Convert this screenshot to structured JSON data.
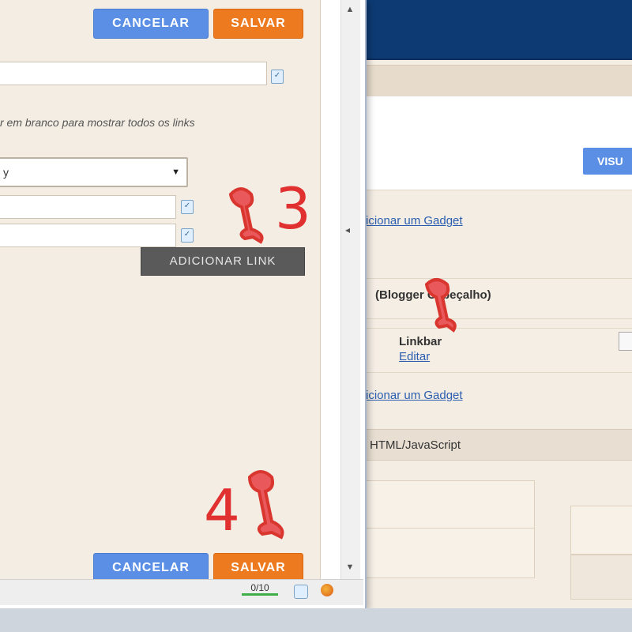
{
  "background_page": {
    "visualizar_label": "VISU",
    "add_gadget_link_1": "icionar um Gadget",
    "header_row_label": "(Blogger Cabeçalho)",
    "linkbar_title": "Linkbar",
    "linkbar_edit_link": "Editar",
    "add_gadget_link_2": "icionar um Gadget",
    "html_bar_label": "HTML/JavaScript"
  },
  "dialog": {
    "top_cancel": "CANCELAR",
    "top_save": "SALVAR",
    "hint_text": "r em branco para mostrar todos os links",
    "select_value": "y",
    "add_link_button": "ADICIONAR LINK",
    "bottom_cancel": "CANCELAR",
    "bottom_save": "SALVAR",
    "char_counter": "0/10"
  },
  "annotations": {
    "step_3": "3",
    "step_4": "4"
  },
  "colors": {
    "accent_blue": "#5b8fe6",
    "accent_orange": "#ee7a20",
    "annotation_red": "#e0302f",
    "header_navy": "#0d3a73"
  },
  "icons": [
    "pin-icon",
    "spellcheck-icon",
    "chevron-down-icon",
    "firefox-icon"
  ]
}
